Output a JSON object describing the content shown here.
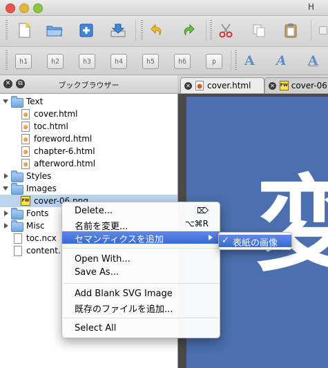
{
  "window": {
    "title_partial": "H"
  },
  "toolbar1": {
    "icons": [
      "new-file-icon",
      "open-folder-icon",
      "add-file-icon",
      "save-icon",
      "undo-icon",
      "redo-icon",
      "cut-icon",
      "copy-icon",
      "paste-icon"
    ]
  },
  "toolbar2": {
    "headings": [
      "h1",
      "h2",
      "h3",
      "h4",
      "h5",
      "h6",
      "p"
    ],
    "text_styles": [
      "A",
      "A",
      "A"
    ]
  },
  "book_browser": {
    "title": "ブックブラウザー",
    "items": [
      {
        "label": "Text",
        "kind": "folder",
        "expanded": true
      },
      {
        "label": "cover.html",
        "kind": "html"
      },
      {
        "label": "toc.html",
        "kind": "html"
      },
      {
        "label": "foreword.html",
        "kind": "html"
      },
      {
        "label": "chapter-6.html",
        "kind": "html"
      },
      {
        "label": "afterword.html",
        "kind": "html"
      },
      {
        "label": "Styles",
        "kind": "folder",
        "expanded": false
      },
      {
        "label": "Images",
        "kind": "folder",
        "expanded": true
      },
      {
        "label": "cover-06.png",
        "kind": "image",
        "selected": true
      },
      {
        "label": "Fonts",
        "kind": "folder",
        "expanded": false
      },
      {
        "label": "Misc",
        "kind": "folder",
        "expanded": false
      },
      {
        "label": "toc.ncx",
        "kind": "doc"
      },
      {
        "label": "content.",
        "kind": "doc"
      }
    ]
  },
  "tabs": [
    {
      "label": "cover.html",
      "active": true
    },
    {
      "label": "cover-06.",
      "active": false
    }
  ],
  "preview": {
    "visible_char": "変"
  },
  "context_menu": {
    "items": [
      {
        "label": "Delete...",
        "shortcut": "⌦"
      },
      {
        "label": "名前を変更...",
        "shortcut": "⌥⌘R"
      },
      {
        "label": "セマンティクスを追加",
        "highlighted": true,
        "has_submenu": true
      },
      {
        "label": "Open With..."
      },
      {
        "label": "Save As..."
      },
      {
        "label": "Add Blank SVG Image"
      },
      {
        "label": "既存のファイルを追加..."
      },
      {
        "label": "Select All"
      }
    ],
    "submenu": {
      "label": "表紙の画像",
      "checked": true,
      "check_mark": "✓"
    }
  }
}
